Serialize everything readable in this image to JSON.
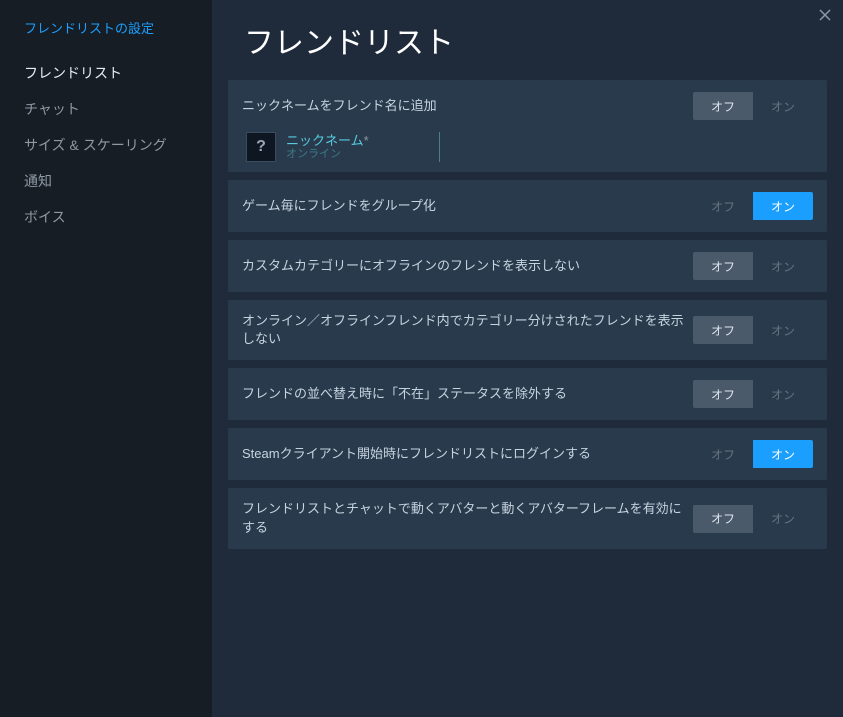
{
  "sidebar": {
    "title": "フレンドリストの設定",
    "items": [
      {
        "label": "フレンドリスト",
        "active": true
      },
      {
        "label": "チャット",
        "active": false
      },
      {
        "label": "サイズ & スケーリング",
        "active": false
      },
      {
        "label": "通知",
        "active": false
      },
      {
        "label": "ボイス",
        "active": false
      }
    ]
  },
  "page": {
    "title": "フレンドリスト"
  },
  "toggle_labels": {
    "off": "オフ",
    "on": "オン"
  },
  "avatar_glyph": "?",
  "preview": {
    "name": "ニックネーム",
    "asterisk": "*",
    "status": "オンライン"
  },
  "settings": [
    {
      "label": "ニックネームをフレンド名に追加",
      "value": "off",
      "has_preview": true
    },
    {
      "label": "ゲーム毎にフレンドをグループ化",
      "value": "on",
      "has_preview": false
    },
    {
      "label": "カスタムカテゴリーにオフラインのフレンドを表示しない",
      "value": "off",
      "has_preview": false
    },
    {
      "label": "オンライン／オフラインフレンド内でカテゴリー分けされたフレンドを表示しない",
      "value": "off",
      "has_preview": false
    },
    {
      "label": "フレンドの並べ替え時に「不在」ステータスを除外する",
      "value": "off",
      "has_preview": false
    },
    {
      "label": "Steamクライアント開始時にフレンドリストにログインする",
      "value": "on",
      "has_preview": false
    },
    {
      "label": "フレンドリストとチャットで動くアバターと動くアバターフレームを有効にする",
      "value": "off",
      "has_preview": false
    }
  ]
}
